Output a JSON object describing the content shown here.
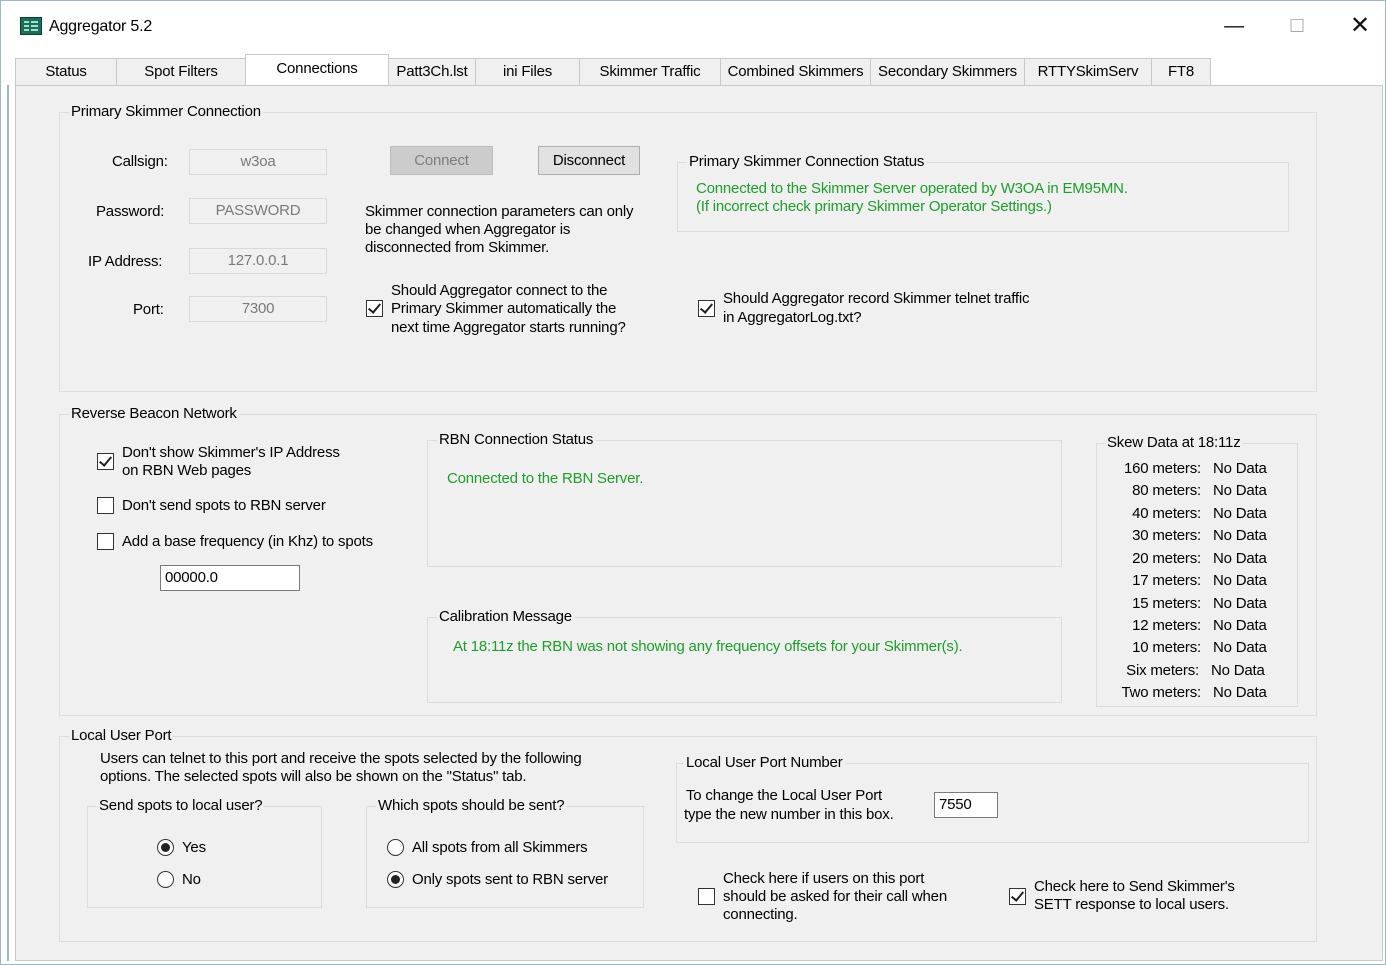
{
  "window": {
    "title": "Aggregator 5.2"
  },
  "tabs": [
    "Status",
    "Spot Filters",
    "Connections",
    "Patt3Ch.lst",
    "ini Files",
    "Skimmer Traffic",
    "Combined Skimmers",
    "Secondary Skimmers",
    "RTTYSkimServ",
    "FT8"
  ],
  "active_tab": "Connections",
  "primary": {
    "group_label": "Primary Skimmer Connection",
    "callsign_label": "Callsign:",
    "callsign_value": "w3oa",
    "password_label": "Password:",
    "password_value": "PASSWORD",
    "ip_label": "IP Address:",
    "ip_value": "127.0.0.1",
    "port_label": "Port:",
    "port_value": "7300",
    "connect_label": "Connect",
    "disconnect_label": "Disconnect",
    "note_line1": "Skimmer connection parameters can only",
    "note_line2": "be changed when Aggregator is",
    "note_line3": "disconnected from Skimmer.",
    "auto_line1": "Should Aggregator connect to the",
    "auto_line2": "Primary Skimmer automatically the",
    "auto_line3": "next time Aggregator starts running?",
    "status_group_label": "Primary Skimmer Connection Status",
    "status_line1": "Connected to the Skimmer Server operated by W3OA in EM95MN.",
    "status_line2": "(If incorrect check primary Skimmer Operator Settings.)",
    "record_line1": "Should Aggregator record Skimmer telnet traffic",
    "record_line2": "in AggregatorLog.txt?"
  },
  "rbn": {
    "group_label": "Reverse Beacon Network",
    "hide_ip_line1": "Don't show Skimmer's IP Address",
    "hide_ip_line2": "on RBN Web pages",
    "no_send_label": "Don't send spots to RBN server",
    "base_freq_label": "Add a base frequency (in Khz) to spots",
    "base_freq_value": "00000.0",
    "status_group_label": "RBN Connection Status",
    "status_text": "Connected to the RBN Server.",
    "calib_group_label": "Calibration Message",
    "calib_text": "At 18:11z the RBN was not showing any frequency offsets for your Skimmer(s).",
    "skew_group_label": "Skew Data at 18:11z",
    "skew": [
      {
        "band": "160 meters:",
        "value": "No Data"
      },
      {
        "band": "80 meters:",
        "value": "No Data"
      },
      {
        "band": "40 meters:",
        "value": "No Data"
      },
      {
        "band": "30 meters:",
        "value": "No Data"
      },
      {
        "band": "20 meters:",
        "value": "No Data"
      },
      {
        "band": "17 meters:",
        "value": "No Data"
      },
      {
        "band": "15 meters:",
        "value": "No Data"
      },
      {
        "band": "12 meters:",
        "value": "No Data"
      },
      {
        "band": "10 meters:",
        "value": "No Data"
      },
      {
        "band": "Six meters:",
        "value": "No Data"
      },
      {
        "band": "Two meters:",
        "value": "No Data"
      }
    ]
  },
  "local": {
    "group_label": "Local User Port",
    "desc_line1": "Users can telnet to this port and receive the spots selected by the following",
    "desc_line2": "options.  The selected spots will also be shown on the \"Status\" tab.",
    "send_group_label": "Send spots to local user?",
    "yes_label": "Yes",
    "no_label": "No",
    "which_group_label": "Which spots should be sent?",
    "all_label": "All spots from all Skimmers",
    "only_label": "Only spots sent to RBN server",
    "port_group_label": "Local User Port Number",
    "port_desc_line1": "To change the Local User Port",
    "port_desc_line2": "type the new number in this box.",
    "port_value": "7550",
    "ask_call_line1": "Check here if users on this port",
    "ask_call_line2": "should be asked for their call when",
    "ask_call_line3": "connecting.",
    "sett_line1": "Check here to Send Skimmer's",
    "sett_line2": "SETT response to local users."
  },
  "state": {
    "auto_connect": true,
    "record_traffic": true,
    "hide_ip": true,
    "no_send": false,
    "base_freq": false,
    "send_local": "Yes",
    "which_spots": "Only spots sent to RBN server",
    "ask_call": false,
    "send_sett": true
  }
}
